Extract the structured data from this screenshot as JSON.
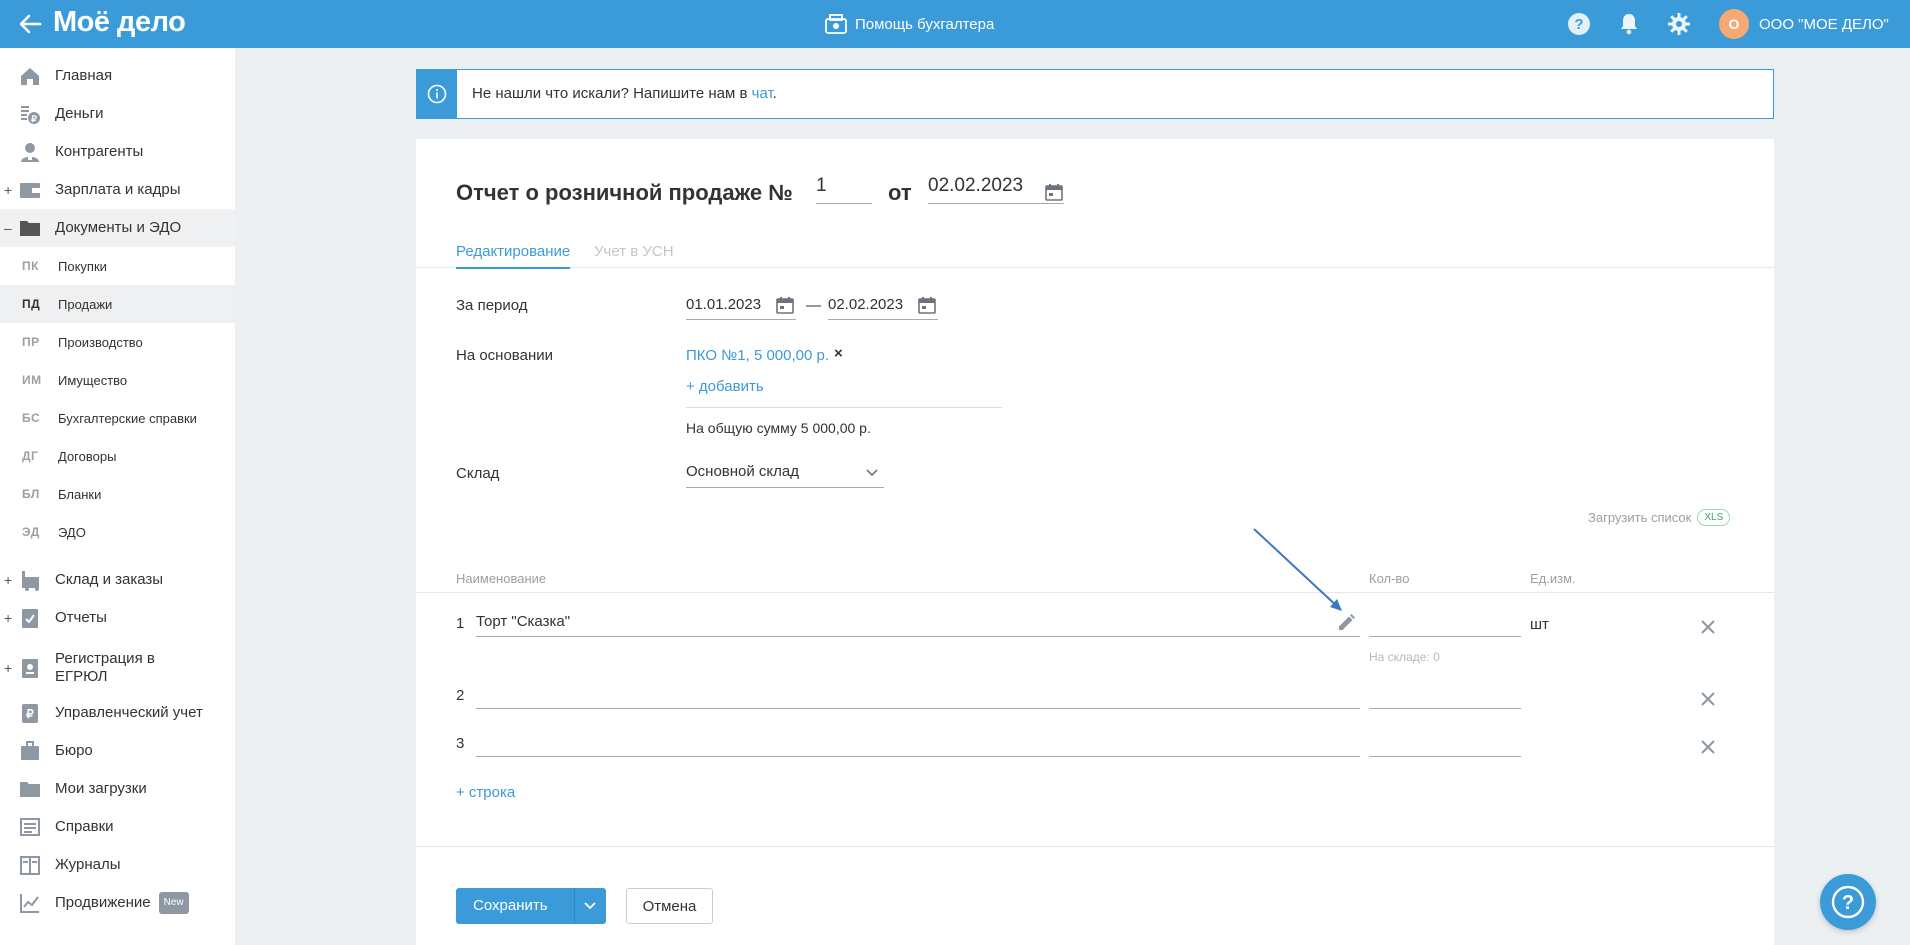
{
  "header": {
    "logo": "Моё дело",
    "help_label": "Помощь бухгалтера",
    "org_initial": "О",
    "org_name": "ООО \"МОЕ ДЕЛО\""
  },
  "sidebar": {
    "items": [
      {
        "label": "Главная"
      },
      {
        "label": "Деньги"
      },
      {
        "label": "Контрагенты"
      },
      {
        "label": "Зарплата и кадры",
        "toggle": "+"
      },
      {
        "label": "Документы и ЭДО",
        "toggle": "–"
      },
      {
        "label": "Склад и заказы",
        "toggle": "+"
      },
      {
        "label": "Отчеты",
        "toggle": "+"
      },
      {
        "label": "Регистрация в",
        "label2": "ЕГРЮЛ",
        "toggle": "+"
      },
      {
        "label": "Управленческий учет"
      },
      {
        "label": "Бюро"
      },
      {
        "label": "Мои загрузки"
      },
      {
        "label": "Справки"
      },
      {
        "label": "Журналы"
      },
      {
        "label": "Продвижение",
        "badge": "New"
      }
    ],
    "sub_items": [
      {
        "abbr": "ПК",
        "label": "Покупки"
      },
      {
        "abbr": "ПД",
        "label": "Продажи"
      },
      {
        "abbr": "ПР",
        "label": "Производство"
      },
      {
        "abbr": "ИМ",
        "label": "Имущество"
      },
      {
        "abbr": "БС",
        "label": "Бухгалтерские справки"
      },
      {
        "abbr": "ДГ",
        "label": "Договоры"
      },
      {
        "abbr": "БЛ",
        "label": "Бланки"
      },
      {
        "abbr": "ЭД",
        "label": "ЭДО"
      }
    ]
  },
  "banner": {
    "text": "Не нашли что искали? Напишите нам в ",
    "link": "чат",
    "end": "."
  },
  "document": {
    "title": "Отчет о розничной продаже №",
    "number": "1",
    "from_label": "от",
    "date": "02.02.2023",
    "tabs": [
      "Редактирование",
      "Учет в УСН"
    ],
    "period_label": "За период",
    "period_from": "01.01.2023",
    "period_dash": "—",
    "period_to": "02.02.2023",
    "basis_label": "На основании",
    "basis_doc": "ПКО №1, 5 000,00 р.",
    "basis_remove": "×",
    "add_link": "+ добавить",
    "total_text": "На общую сумму 5 000,00 р.",
    "warehouse_label": "Склад",
    "warehouse_value": "Основной склад",
    "upload_label": "Загрузить список",
    "upload_badge": "XLS",
    "columns": {
      "name": "Наименование",
      "qty": "Кол-во",
      "unit": "Ед.изм."
    },
    "rows": [
      {
        "num": "1",
        "name": "Торт \"Сказка\"",
        "qty": "",
        "unit": "шт",
        "stock": "На складе: 0"
      },
      {
        "num": "2",
        "name": "",
        "qty": "",
        "unit": ""
      },
      {
        "num": "3",
        "name": "",
        "qty": "",
        "unit": ""
      }
    ],
    "add_row": "+ строка"
  },
  "actions": {
    "save": "Сохранить",
    "cancel": "Отмена"
  },
  "colors": {
    "accent": "#3b9ad8",
    "background": "#edf0f2"
  }
}
